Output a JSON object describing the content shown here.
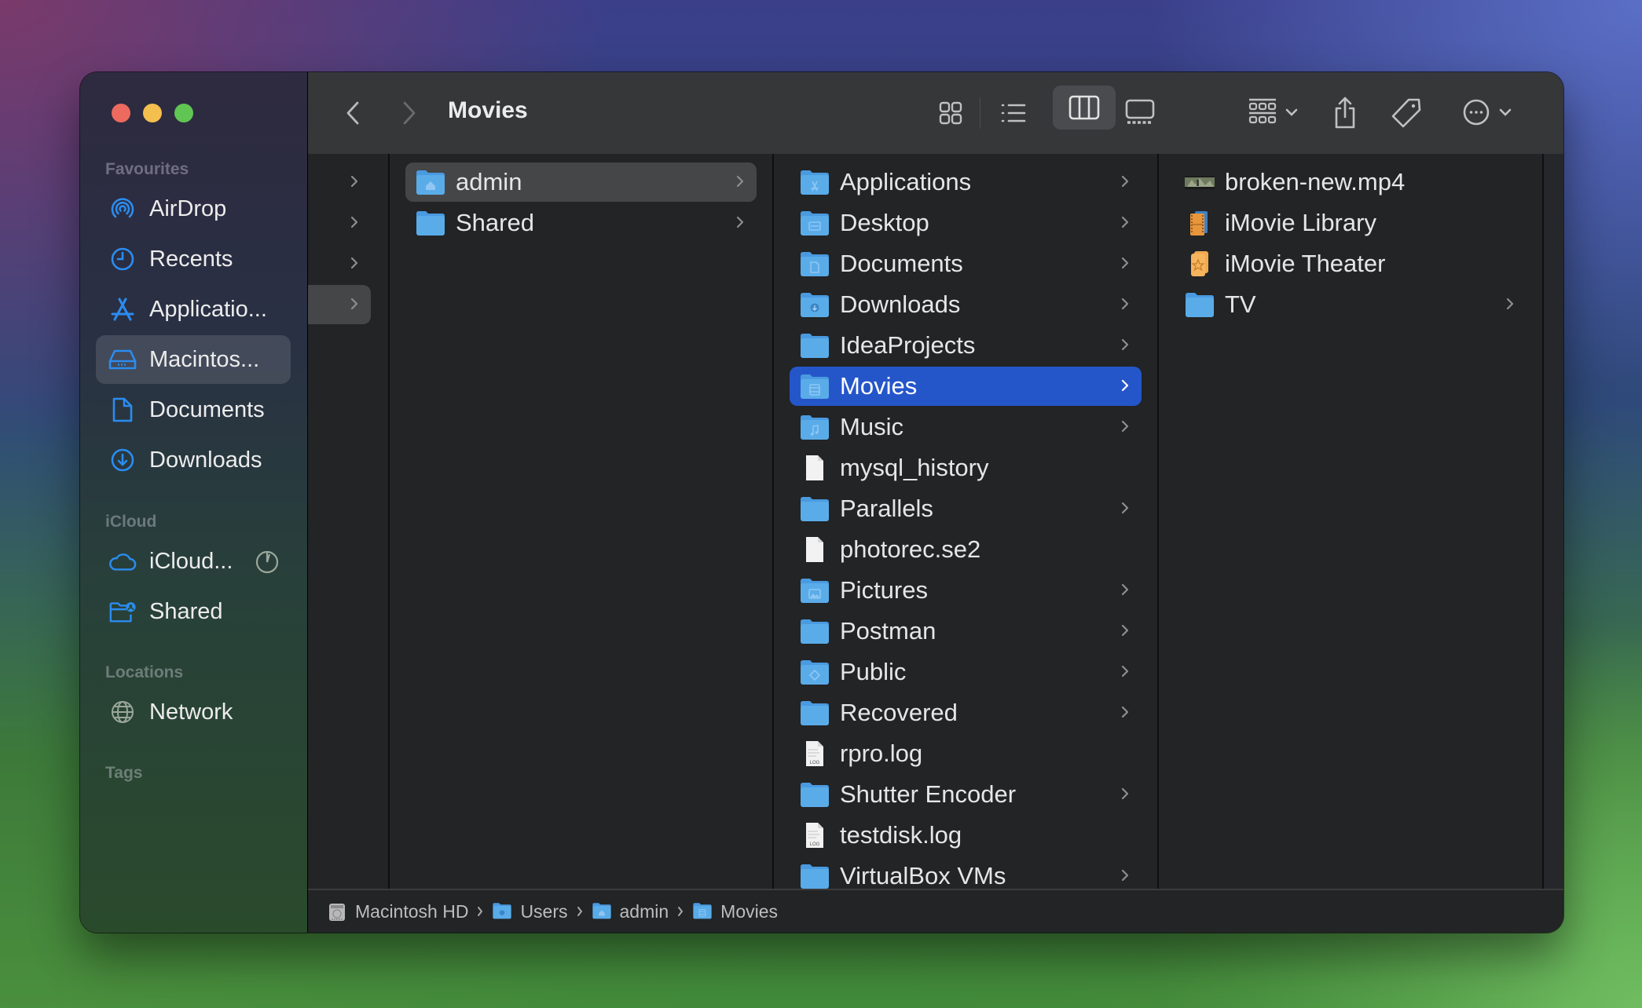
{
  "window": {
    "title": "Movies"
  },
  "sidebar": {
    "sections": [
      {
        "label": "Favourites"
      },
      {
        "label": "iCloud"
      },
      {
        "label": "Locations"
      },
      {
        "label": "Tags"
      }
    ],
    "favourites": [
      {
        "label": "AirDrop",
        "icon": "airdrop-icon"
      },
      {
        "label": "Recents",
        "icon": "clock-icon"
      },
      {
        "label": "Applicatio...",
        "icon": "app-store-icon"
      },
      {
        "label": "Macintos...",
        "icon": "hard-drive-icon",
        "selected": true
      },
      {
        "label": "Documents",
        "icon": "document-icon"
      },
      {
        "label": "Downloads",
        "icon": "download-circle-icon"
      }
    ],
    "icloud": [
      {
        "label": "iCloud...",
        "icon": "cloud-icon",
        "extra": "sync-progress-icon"
      },
      {
        "label": "Shared",
        "icon": "shared-folder-icon"
      }
    ],
    "locations": [
      {
        "label": "Network",
        "icon": "globe-icon"
      }
    ]
  },
  "toolbar": {
    "back": "back-chevron-icon",
    "forward": "forward-chevron-icon",
    "title": "Movies",
    "views": [
      "icon-view",
      "list-view",
      "column-view",
      "gallery-view"
    ],
    "selected_view": "column-view",
    "group_label": "group-by-icon",
    "share": "share-icon",
    "tag": "tag-icon",
    "more": "more-actions-icon",
    "search": "search-icon"
  },
  "columns": {
    "col1": {
      "rows": [
        {
          "label": "",
          "chevron": true
        },
        {
          "label": "",
          "chevron": true
        },
        {
          "label": "",
          "chevron": true
        },
        {
          "label": "",
          "chevron": true,
          "selected": "gray"
        }
      ]
    },
    "col2": {
      "rows": [
        {
          "label": "admin",
          "icon": "home-folder",
          "chevron": true,
          "selected": "gray"
        },
        {
          "label": "Shared",
          "icon": "folder",
          "chevron": true
        }
      ]
    },
    "col3": {
      "rows": [
        {
          "label": "Applications",
          "icon": "applications-folder",
          "chevron": true
        },
        {
          "label": "Desktop",
          "icon": "desktop-folder",
          "chevron": true
        },
        {
          "label": "Documents",
          "icon": "documents-folder",
          "chevron": true
        },
        {
          "label": "Downloads",
          "icon": "downloads-folder",
          "chevron": true
        },
        {
          "label": "IdeaProjects",
          "icon": "folder",
          "chevron": true
        },
        {
          "label": "Movies",
          "icon": "movies-folder",
          "chevron": true,
          "selected": "blue"
        },
        {
          "label": "Music",
          "icon": "music-folder",
          "chevron": true
        },
        {
          "label": "mysql_history",
          "icon": "file",
          "chevron": false
        },
        {
          "label": "Parallels",
          "icon": "folder",
          "chevron": true
        },
        {
          "label": "photorec.se2",
          "icon": "file",
          "chevron": false
        },
        {
          "label": "Pictures",
          "icon": "pictures-folder",
          "chevron": true
        },
        {
          "label": "Postman",
          "icon": "folder",
          "chevron": true
        },
        {
          "label": "Public",
          "icon": "public-folder",
          "chevron": true
        },
        {
          "label": "Recovered",
          "icon": "folder",
          "chevron": true
        },
        {
          "label": "rpro.log",
          "icon": "log-file",
          "chevron": false
        },
        {
          "label": "Shutter Encoder",
          "icon": "folder",
          "chevron": true
        },
        {
          "label": "testdisk.log",
          "icon": "log-file",
          "chevron": false
        },
        {
          "label": "VirtualBox VMs",
          "icon": "folder",
          "chevron": true
        }
      ]
    },
    "col4": {
      "rows": [
        {
          "label": "broken-new.mp4",
          "icon": "video-thumbnail",
          "chevron": false
        },
        {
          "label": "iMovie Library",
          "icon": "imovie-library",
          "chevron": false
        },
        {
          "label": "iMovie Theater",
          "icon": "imovie-theater",
          "chevron": false
        },
        {
          "label": "TV",
          "icon": "folder",
          "chevron": true
        }
      ]
    }
  },
  "pathbar": {
    "segments": [
      {
        "label": "Macintosh HD",
        "icon": "hard-drive-icon"
      },
      {
        "label": "Users",
        "icon": "users-folder-icon"
      },
      {
        "label": "admin",
        "icon": "home-folder-icon"
      },
      {
        "label": "Movies",
        "icon": "movies-folder-icon"
      }
    ]
  },
  "colors": {
    "accent": "#2556c9",
    "folder_blue": "#5aa9ea",
    "sidebar_icon": "#2b8cf0"
  }
}
